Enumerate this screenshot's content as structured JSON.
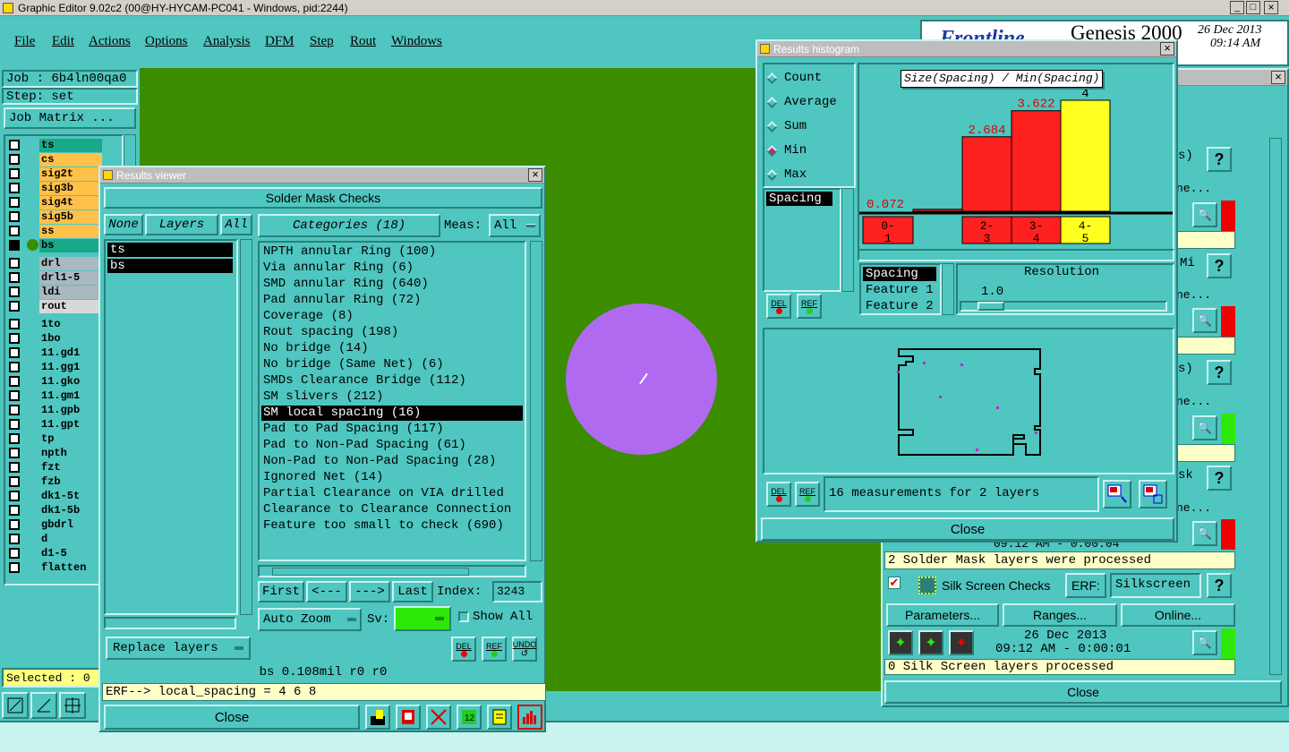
{
  "app": {
    "title": "Graphic Editor 9.02c2 (00@HY-HYCAM-PC041 - Windows, pid:2244)",
    "brand": "Genesis 2000",
    "date": "26 Dec 2013",
    "time": "09:14 AM",
    "brand_partial": "Frontline"
  },
  "menu": [
    "File",
    "Edit",
    "Actions",
    "Options",
    "Analysis",
    "DFM",
    "Step",
    "Rout",
    "Windows"
  ],
  "job": {
    "job_label": "Job : 6b4ln00qa0",
    "step_label": "Step: set",
    "matrix_button": "Job Matrix ..."
  },
  "layers": [
    {
      "name": "ts",
      "color": "#1aa88a"
    },
    {
      "name": "cs",
      "color": "#ffc14a"
    },
    {
      "name": "sig2t",
      "color": "#ffc14a"
    },
    {
      "name": "sig3b",
      "color": "#ffc14a"
    },
    {
      "name": "sig4t",
      "color": "#ffc14a"
    },
    {
      "name": "sig5b",
      "color": "#ffc14a"
    },
    {
      "name": "ss",
      "color": "#ffc14a"
    },
    {
      "name": "bs",
      "color": "#1aa88a"
    },
    {
      "name": "drl",
      "color": "#aab8c0"
    },
    {
      "name": "drl1-5",
      "color": "#aab8c0"
    },
    {
      "name": "ldi",
      "color": "#aab8c0"
    },
    {
      "name": "rout",
      "color": "#d8d8d8"
    },
    {
      "name": "1to",
      "color": "#4fc6c0"
    },
    {
      "name": "1bo",
      "color": "#4fc6c0"
    },
    {
      "name": "11.gd1",
      "color": "#4fc6c0"
    },
    {
      "name": "11.gg1",
      "color": "#4fc6c0"
    },
    {
      "name": "11.gko",
      "color": "#4fc6c0"
    },
    {
      "name": "11.gm1",
      "color": "#4fc6c0"
    },
    {
      "name": "11.gpb",
      "color": "#4fc6c0"
    },
    {
      "name": "11.gpt",
      "color": "#4fc6c0"
    },
    {
      "name": "tp",
      "color": "#4fc6c0"
    },
    {
      "name": "npth",
      "color": "#4fc6c0"
    },
    {
      "name": "fzt",
      "color": "#4fc6c0"
    },
    {
      "name": "fzb",
      "color": "#4fc6c0"
    },
    {
      "name": "dk1-5t",
      "color": "#4fc6c0"
    },
    {
      "name": "dk1-5b",
      "color": "#4fc6c0"
    },
    {
      "name": "gbdrl",
      "color": "#4fc6c0"
    },
    {
      "name": "d",
      "color": "#4fc6c0"
    },
    {
      "name": "d1-5",
      "color": "#4fc6c0"
    },
    {
      "name": "flatten",
      "color": "#4fc6c0"
    }
  ],
  "selected_label": "Selected : 0",
  "results_viewer": {
    "window_title": "Results viewer",
    "header": "Solder Mask Checks",
    "none_btn": "None",
    "layers_btn": "Layers",
    "all_btn": "All",
    "layer_list": [
      "ts",
      "bs"
    ],
    "categories_btn": "Categories (18)",
    "meas_label": "Meas:",
    "meas_value": "All",
    "categories": [
      "NPTH annular Ring (100)",
      "Via annular Ring (6)",
      "SMD annular Ring (640)",
      "Pad annular Ring (72)",
      "Coverage (8)",
      "Rout spacing (198)",
      "No bridge (14)",
      "No bridge (Same Net) (6)",
      "SMDs Clearance Bridge (112)",
      "SM slivers (212)",
      "SM local spacing (16)",
      "Pad to Pad Spacing (117)",
      "Pad to Non-Pad Spacing (61)",
      "Non-Pad to Non-Pad Spacing (28)",
      "Ignored Net (14)",
      "Partial Clearance on VIA drilled",
      "Clearance to Clearance Connection",
      "Feature too small to check (690)"
    ],
    "selected_index": 10,
    "nav": {
      "first": "First",
      "prev": "<---",
      "next": "--->",
      "last": "Last",
      "index_label": "Index:",
      "index_value": "3243"
    },
    "auto_zoom": "Auto Zoom",
    "sv_label": "Sv:",
    "show_all": "Show All",
    "replace_layers": "Replace layers",
    "del": "DEL",
    "ref": "REF",
    "undo": "UNDO",
    "status": "bs 0.108mil  r0  r0",
    "erf": "ERF--> local_spacing = 4 6 8",
    "close": "Close"
  },
  "histogram": {
    "window_title": "Results histogram",
    "modes": [
      "Count",
      "Average",
      "Sum",
      "Min",
      "Max"
    ],
    "selected_mode": "Min",
    "measure_list": [
      "Spacing"
    ],
    "chart_title": "Size(Spacing) / Min(Spacing)",
    "del": "DEL",
    "ref": "REF",
    "sort_list": [
      "Spacing",
      "Feature 1",
      "Feature 2"
    ],
    "resolution_label": "Resolution",
    "resolution_value": "1.0",
    "summary": "16 measurements for 2 layers",
    "close": "Close"
  },
  "chart_data": {
    "type": "bar",
    "title": "Size(Spacing) / Min(Spacing)",
    "categories": [
      "0-1",
      "2-3",
      "3-4",
      "4-5"
    ],
    "category_lines": [
      [
        "0-",
        "1"
      ],
      [
        "2-",
        "3"
      ],
      [
        "3-",
        "4"
      ],
      [
        "4-",
        "5"
      ]
    ],
    "values": [
      0.072,
      2.684,
      3.622,
      4
    ],
    "value_labels": [
      "0.072",
      "2.684",
      "3.622",
      "4"
    ],
    "colors": [
      "#ff2020",
      "#ff2020",
      "#ff2020",
      "#ffff20"
    ],
    "ylim": [
      0,
      4
    ]
  },
  "checks_panel": {
    "solder_status": "2 Solder Mask layers were processed",
    "silk_title": "Silk Screen Checks",
    "erf_label": "ERF:",
    "erf_value": "Silkscreen",
    "parameters": "Parameters...",
    "ranges": "Ranges...",
    "online": "Online...",
    "silk_date": "26 Dec 2013",
    "silk_time": "09:12 AM - 0:00:01",
    "silk_status": "0 Silk Screen layers processed",
    "close": "Close",
    "partial_rows": [
      "s)",
      "ne...",
      "Mi",
      "ne...",
      "s)",
      "ne...",
      "sk",
      "ne..."
    ],
    "partial_time": "09:12 AM - 0:00:04",
    "help": "?"
  },
  "colors": {
    "bg": "#4fc6c0",
    "canvas": "#3c8c00",
    "pad": "#b06af0",
    "bar_red": "#ff2020",
    "bar_yellow": "#ffff20"
  }
}
